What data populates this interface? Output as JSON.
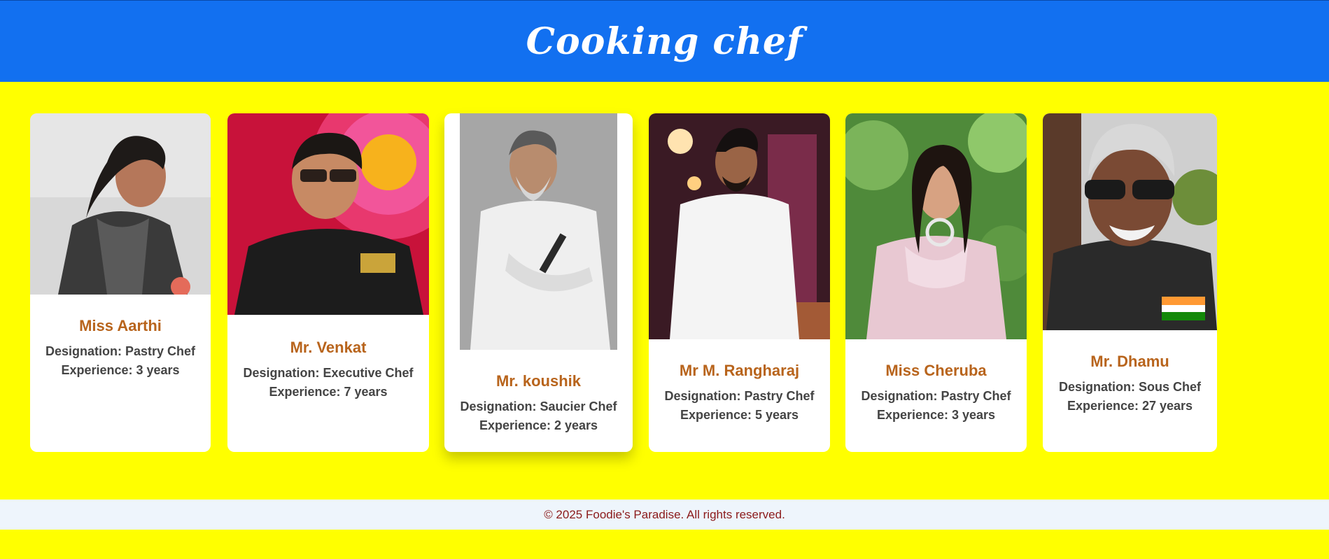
{
  "header": {
    "title": "Cooking chef"
  },
  "chefs": [
    {
      "name": "Miss Aarthi",
      "designation": "Designation: Pastry Chef",
      "experience": "Experience: 3 years"
    },
    {
      "name": "Mr. Venkat",
      "designation": "Designation: Executive Chef",
      "experience": "Experience: 7 years"
    },
    {
      "name": "Mr. koushik",
      "designation": "Designation: Saucier Chef",
      "experience": "Experience: 2 years"
    },
    {
      "name": "Mr M. Rangharaj",
      "designation": "Designation: Pastry Chef",
      "experience": "Experience: 5 years"
    },
    {
      "name": "Miss Cheruba",
      "designation": "Designation: Pastry Chef",
      "experience": "Experience: 3 years"
    },
    {
      "name": "Mr. Dhamu",
      "designation": "Designation: Sous Chef",
      "experience": "Experience: 27 years"
    }
  ],
  "footer": {
    "text": "© 2025 Foodie's Paradise. All rights reserved."
  },
  "colors": {
    "header_bg": "#1270f0",
    "page_bg": "#ffff00",
    "name_color": "#b8641c",
    "footer_text": "#8b1a1a"
  }
}
